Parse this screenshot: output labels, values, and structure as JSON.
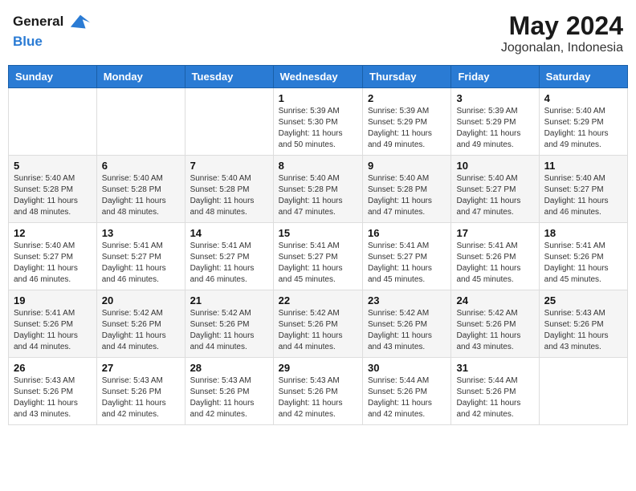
{
  "logo": {
    "line1": "General",
    "line2": "Blue"
  },
  "title": "May 2024",
  "subtitle": "Jogonalan, Indonesia",
  "days_header": [
    "Sunday",
    "Monday",
    "Tuesday",
    "Wednesday",
    "Thursday",
    "Friday",
    "Saturday"
  ],
  "weeks": [
    [
      {
        "day": "",
        "info": ""
      },
      {
        "day": "",
        "info": ""
      },
      {
        "day": "",
        "info": ""
      },
      {
        "day": "1",
        "info": "Sunrise: 5:39 AM\nSunset: 5:30 PM\nDaylight: 11 hours\nand 50 minutes."
      },
      {
        "day": "2",
        "info": "Sunrise: 5:39 AM\nSunset: 5:29 PM\nDaylight: 11 hours\nand 49 minutes."
      },
      {
        "day": "3",
        "info": "Sunrise: 5:39 AM\nSunset: 5:29 PM\nDaylight: 11 hours\nand 49 minutes."
      },
      {
        "day": "4",
        "info": "Sunrise: 5:40 AM\nSunset: 5:29 PM\nDaylight: 11 hours\nand 49 minutes."
      }
    ],
    [
      {
        "day": "5",
        "info": "Sunrise: 5:40 AM\nSunset: 5:28 PM\nDaylight: 11 hours\nand 48 minutes."
      },
      {
        "day": "6",
        "info": "Sunrise: 5:40 AM\nSunset: 5:28 PM\nDaylight: 11 hours\nand 48 minutes."
      },
      {
        "day": "7",
        "info": "Sunrise: 5:40 AM\nSunset: 5:28 PM\nDaylight: 11 hours\nand 48 minutes."
      },
      {
        "day": "8",
        "info": "Sunrise: 5:40 AM\nSunset: 5:28 PM\nDaylight: 11 hours\nand 47 minutes."
      },
      {
        "day": "9",
        "info": "Sunrise: 5:40 AM\nSunset: 5:28 PM\nDaylight: 11 hours\nand 47 minutes."
      },
      {
        "day": "10",
        "info": "Sunrise: 5:40 AM\nSunset: 5:27 PM\nDaylight: 11 hours\nand 47 minutes."
      },
      {
        "day": "11",
        "info": "Sunrise: 5:40 AM\nSunset: 5:27 PM\nDaylight: 11 hours\nand 46 minutes."
      }
    ],
    [
      {
        "day": "12",
        "info": "Sunrise: 5:40 AM\nSunset: 5:27 PM\nDaylight: 11 hours\nand 46 minutes."
      },
      {
        "day": "13",
        "info": "Sunrise: 5:41 AM\nSunset: 5:27 PM\nDaylight: 11 hours\nand 46 minutes."
      },
      {
        "day": "14",
        "info": "Sunrise: 5:41 AM\nSunset: 5:27 PM\nDaylight: 11 hours\nand 46 minutes."
      },
      {
        "day": "15",
        "info": "Sunrise: 5:41 AM\nSunset: 5:27 PM\nDaylight: 11 hours\nand 45 minutes."
      },
      {
        "day": "16",
        "info": "Sunrise: 5:41 AM\nSunset: 5:27 PM\nDaylight: 11 hours\nand 45 minutes."
      },
      {
        "day": "17",
        "info": "Sunrise: 5:41 AM\nSunset: 5:26 PM\nDaylight: 11 hours\nand 45 minutes."
      },
      {
        "day": "18",
        "info": "Sunrise: 5:41 AM\nSunset: 5:26 PM\nDaylight: 11 hours\nand 45 minutes."
      }
    ],
    [
      {
        "day": "19",
        "info": "Sunrise: 5:41 AM\nSunset: 5:26 PM\nDaylight: 11 hours\nand 44 minutes."
      },
      {
        "day": "20",
        "info": "Sunrise: 5:42 AM\nSunset: 5:26 PM\nDaylight: 11 hours\nand 44 minutes."
      },
      {
        "day": "21",
        "info": "Sunrise: 5:42 AM\nSunset: 5:26 PM\nDaylight: 11 hours\nand 44 minutes."
      },
      {
        "day": "22",
        "info": "Sunrise: 5:42 AM\nSunset: 5:26 PM\nDaylight: 11 hours\nand 44 minutes."
      },
      {
        "day": "23",
        "info": "Sunrise: 5:42 AM\nSunset: 5:26 PM\nDaylight: 11 hours\nand 43 minutes."
      },
      {
        "day": "24",
        "info": "Sunrise: 5:42 AM\nSunset: 5:26 PM\nDaylight: 11 hours\nand 43 minutes."
      },
      {
        "day": "25",
        "info": "Sunrise: 5:43 AM\nSunset: 5:26 PM\nDaylight: 11 hours\nand 43 minutes."
      }
    ],
    [
      {
        "day": "26",
        "info": "Sunrise: 5:43 AM\nSunset: 5:26 PM\nDaylight: 11 hours\nand 43 minutes."
      },
      {
        "day": "27",
        "info": "Sunrise: 5:43 AM\nSunset: 5:26 PM\nDaylight: 11 hours\nand 42 minutes."
      },
      {
        "day": "28",
        "info": "Sunrise: 5:43 AM\nSunset: 5:26 PM\nDaylight: 11 hours\nand 42 minutes."
      },
      {
        "day": "29",
        "info": "Sunrise: 5:43 AM\nSunset: 5:26 PM\nDaylight: 11 hours\nand 42 minutes."
      },
      {
        "day": "30",
        "info": "Sunrise: 5:44 AM\nSunset: 5:26 PM\nDaylight: 11 hours\nand 42 minutes."
      },
      {
        "day": "31",
        "info": "Sunrise: 5:44 AM\nSunset: 5:26 PM\nDaylight: 11 hours\nand 42 minutes."
      },
      {
        "day": "",
        "info": ""
      }
    ]
  ]
}
